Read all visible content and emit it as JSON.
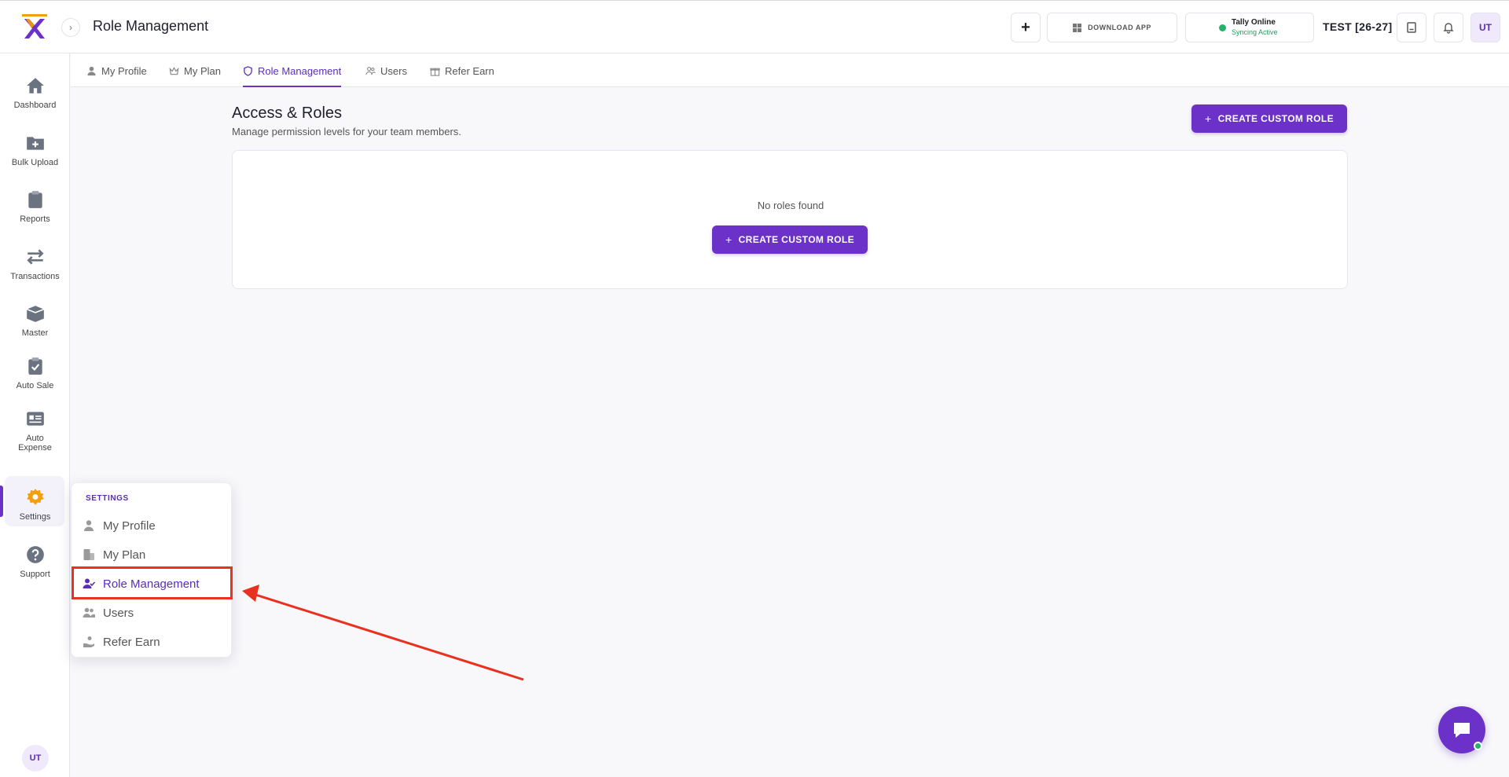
{
  "header": {
    "title": "Role Management",
    "download_label": "DOWNLOAD APP",
    "tally_title": "Tally Online",
    "tally_status": "Syncing Active",
    "company": "TEST [26-27]",
    "user_initials": "UT"
  },
  "sidebar": {
    "items": [
      {
        "label": "Dashboard",
        "icon": "home-icon"
      },
      {
        "label": "Bulk Upload",
        "icon": "folder-plus-icon"
      },
      {
        "label": "Reports",
        "icon": "clipboard-icon"
      },
      {
        "label": "Transactions",
        "icon": "swap-arrows-icon"
      },
      {
        "label": "Master",
        "icon": "box-icon"
      },
      {
        "label": "Auto Sale",
        "icon": "clipboard-check-icon"
      },
      {
        "label": "Auto Expense",
        "icon": "id-card-icon"
      },
      {
        "label": "Settings",
        "icon": "gear-icon"
      },
      {
        "label": "Support",
        "icon": "help-circle-icon"
      }
    ],
    "user_initials": "UT"
  },
  "tabs": [
    {
      "label": "My Profile"
    },
    {
      "label": "My Plan"
    },
    {
      "label": "Role Management"
    },
    {
      "label": "Users"
    },
    {
      "label": "Refer Earn"
    }
  ],
  "main": {
    "title": "Access & Roles",
    "subtitle": "Manage permission levels for your team members.",
    "create_label": "CREATE CUSTOM ROLE",
    "empty_text": "No roles found"
  },
  "popup": {
    "heading": "SETTINGS",
    "items": [
      {
        "label": "My Profile"
      },
      {
        "label": "My Plan"
      },
      {
        "label": "Role Management"
      },
      {
        "label": "Users"
      },
      {
        "label": "Refer Earn"
      }
    ]
  },
  "colors": {
    "accent": "#6b31c9",
    "settings_icon": "#f59e0b",
    "highlight": "#e8311f",
    "online": "#21b36b"
  }
}
